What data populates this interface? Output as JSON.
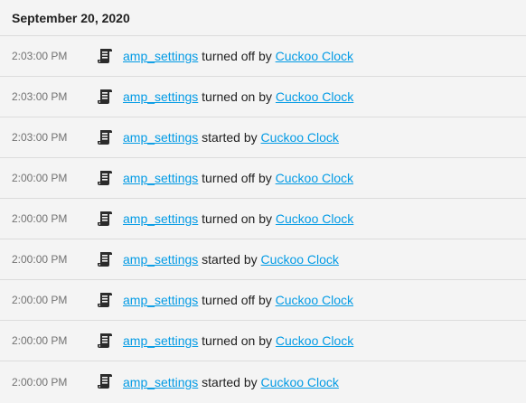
{
  "date_header": "September 20, 2020",
  "entries": [
    {
      "time": "2:03:00 PM",
      "entity": "amp_settings",
      "action": "turned off by",
      "source": "Cuckoo Clock"
    },
    {
      "time": "2:03:00 PM",
      "entity": "amp_settings",
      "action": "turned on by",
      "source": "Cuckoo Clock"
    },
    {
      "time": "2:03:00 PM",
      "entity": "amp_settings",
      "action": "started by",
      "source": "Cuckoo Clock"
    },
    {
      "time": "2:00:00 PM",
      "entity": "amp_settings",
      "action": "turned off by",
      "source": "Cuckoo Clock"
    },
    {
      "time": "2:00:00 PM",
      "entity": "amp_settings",
      "action": "turned on by",
      "source": "Cuckoo Clock"
    },
    {
      "time": "2:00:00 PM",
      "entity": "amp_settings",
      "action": "started by",
      "source": "Cuckoo Clock"
    },
    {
      "time": "2:00:00 PM",
      "entity": "amp_settings",
      "action": "turned off by",
      "source": "Cuckoo Clock"
    },
    {
      "time": "2:00:00 PM",
      "entity": "amp_settings",
      "action": "turned on by",
      "source": "Cuckoo Clock"
    },
    {
      "time": "2:00:00 PM",
      "entity": "amp_settings",
      "action": "started by",
      "source": "Cuckoo Clock"
    }
  ],
  "icon": "script-text-icon",
  "colors": {
    "link": "#039be5",
    "text": "#212121",
    "time": "#727272",
    "divider": "#dcdcdc",
    "background": "#f4f4f4"
  }
}
